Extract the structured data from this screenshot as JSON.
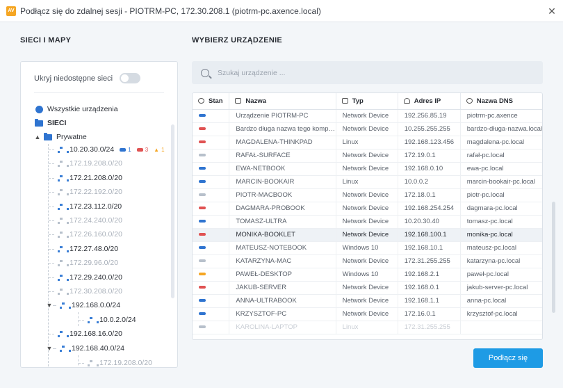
{
  "window": {
    "title": "Podłącz się do zdalnej sesji - PIOTRM-PC, 172.30.208.1 (piotrm-pc.axence.local)",
    "close": "✕"
  },
  "left": {
    "title": "SIECI I MAPY",
    "toggle_label": "Ukryj niedostępne sieci",
    "all_devices": "Wszystkie urządzenia",
    "networks": "SIECI",
    "private": "Prywatne",
    "badge_blue": "1",
    "badge_red": "3",
    "badge_warn": "1",
    "nets": [
      {
        "label": "10.20.30.0/24"
      },
      {
        "label": "172.19.208.0/20"
      },
      {
        "label": "172.21.208.0/20"
      },
      {
        "label": "172.22.192.0/20"
      },
      {
        "label": "172.23.112.0/20"
      },
      {
        "label": "172.24.240.0/20"
      },
      {
        "label": "172.26.160.0/20"
      },
      {
        "label": "172.27.48.0/20"
      },
      {
        "label": "172.29.96.0/20"
      },
      {
        "label": "172.29.240.0/20"
      },
      {
        "label": "172.30.208.0/20"
      },
      {
        "label": "192.168.0.0/24"
      },
      {
        "label": "10.0.2.0/24"
      },
      {
        "label": "192.168.16.0/20"
      },
      {
        "label": "192.168.40.0/24"
      },
      {
        "label": "172.19.208.0/20"
      }
    ]
  },
  "right": {
    "title": "WYBIERZ URZĄDZENIE",
    "search_placeholder": "Szukaj urządzenie ...",
    "columns": {
      "status": "Stan",
      "name": "Nazwa",
      "type": "Typ",
      "ip": "Adres IP",
      "dns": "Nazwa DNS"
    },
    "rows": [
      {
        "status": "#2f74d0",
        "name": "Urządzenie PIOTRM-PC",
        "type": "Network Device",
        "ip": "192.256.85.19",
        "dns": "piotrm-pc.axence"
      },
      {
        "status": "#e05252",
        "name": "Bardzo długa nazwa tego komputera",
        "type": "Network Device",
        "ip": "10.255.255.255",
        "dns": "bardzo-długa-nazwa.local"
      },
      {
        "status": "#e05252",
        "name": "MAGDALENA-THINKPAD",
        "type": "Linux",
        "ip": "192.168.123.456",
        "dns": "magdalena-pc.local"
      },
      {
        "status": "#b7c0cb",
        "name": "RAFAŁ-SURFACE",
        "type": "Network Device",
        "ip": "172.19.0.1",
        "dns": "rafał-pc.local"
      },
      {
        "status": "#2f74d0",
        "name": "EWA-NETBOOK",
        "type": "Network Device",
        "ip": "192.168.0.10",
        "dns": "ewa-pc.local"
      },
      {
        "status": "#2f74d0",
        "name": "MARCIN-BOOKAIR",
        "type": "Linux",
        "ip": "10.0.0.2",
        "dns": "marcin-bookair-pc.local"
      },
      {
        "status": "#b7c0cb",
        "name": "PIOTR-MACBOOK",
        "type": "Network Device",
        "ip": "172.18.0.1",
        "dns": "piotr-pc.local"
      },
      {
        "status": "#e05252",
        "name": "DAGMARA-PROBOOK",
        "type": "Network Device",
        "ip": "192.168.254.254",
        "dns": "dagmara-pc.local"
      },
      {
        "status": "#2f74d0",
        "name": "TOMASZ-ULTRA",
        "type": "Network Device",
        "ip": "10.20.30.40",
        "dns": "tomasz-pc.local"
      },
      {
        "status": "#e05252",
        "name": "MONIKA-BOOKLET",
        "type": "Network Device",
        "ip": "192.168.100.1",
        "dns": "monika-pc.local"
      },
      {
        "status": "#2f74d0",
        "name": "MATEUSZ-NOTEBOOK",
        "type": "Windows 10",
        "ip": "192.168.10.1",
        "dns": "mateusz-pc.local"
      },
      {
        "status": "#b7c0cb",
        "name": "KATARZYNA-MAC",
        "type": "Network Device",
        "ip": "172.31.255.255",
        "dns": "katarzyna-pc.local"
      },
      {
        "status": "#f5a623",
        "name": "PAWEŁ-DESKTOP",
        "type": "Windows 10",
        "ip": "192.168.2.1",
        "dns": "paweł-pc.local"
      },
      {
        "status": "#e05252",
        "name": "JAKUB-SERVER",
        "type": "Network Device",
        "ip": "192.168.0.1",
        "dns": "jakub-server-pc.local"
      },
      {
        "status": "#2f74d0",
        "name": "ANNA-ULTRABOOK",
        "type": "Network Device",
        "ip": "192.168.1.1",
        "dns": "anna-pc.local"
      },
      {
        "status": "#2f74d0",
        "name": "KRZYSZTOF-PC",
        "type": "Network Device",
        "ip": "172.16.0.1",
        "dns": "krzysztof-pc.local"
      },
      {
        "status": "#b7c0cb",
        "name": "KAROLINA-LAPTOP",
        "type": "Linux",
        "ip": "172.31.255.255",
        "dns": ""
      }
    ],
    "connect": "Podłącz się"
  }
}
